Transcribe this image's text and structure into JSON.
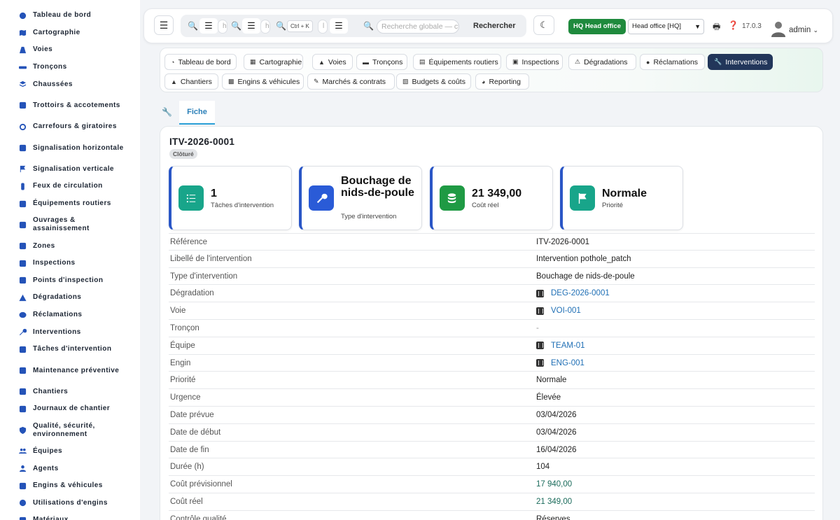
{
  "sidebar": {
    "items": [
      {
        "label": "Tableau de bord",
        "icon": "dashboard-icon"
      },
      {
        "label": "Cartographie",
        "icon": "map-icon"
      },
      {
        "label": "Voies",
        "icon": "road-icon"
      },
      {
        "label": "Tronçons",
        "icon": "segment-icon"
      },
      {
        "label": "Chaussées",
        "icon": "layers-icon"
      },
      {
        "label": "Trottoirs & accotements",
        "icon": "sidewalk-icon"
      },
      {
        "label": "Carrefours & giratoires",
        "icon": "roundabout-icon"
      },
      {
        "label": "Signalisation horizontale",
        "icon": "marking-icon"
      },
      {
        "label": "Signalisation verticale",
        "icon": "sign-icon"
      },
      {
        "label": "Feux de circulation",
        "icon": "traffic-light-icon"
      },
      {
        "label": "Équipements routiers",
        "icon": "equipment-icon"
      },
      {
        "label": "Ouvrages & assainissement",
        "icon": "water-icon"
      },
      {
        "label": "Zones",
        "icon": "zones-icon"
      },
      {
        "label": "Inspections",
        "icon": "clipboard-icon"
      },
      {
        "label": "Points d'inspection",
        "icon": "list-icon"
      },
      {
        "label": "Dégradations",
        "icon": "warning-icon"
      },
      {
        "label": "Réclamations",
        "icon": "comment-icon"
      },
      {
        "label": "Interventions",
        "icon": "wrench-icon"
      },
      {
        "label": "Tâches d'intervention",
        "icon": "tasks-icon"
      },
      {
        "label": "Maintenance préventive",
        "icon": "calendar-icon"
      },
      {
        "label": "Chantiers",
        "icon": "hardhat-icon"
      },
      {
        "label": "Journaux de chantier",
        "icon": "book-icon"
      },
      {
        "label": "Qualité, sécurité, environnement",
        "icon": "shield-icon"
      },
      {
        "label": "Équipes",
        "icon": "users-icon"
      },
      {
        "label": "Agents",
        "icon": "user-icon"
      },
      {
        "label": "Engins & véhicules",
        "icon": "truck-icon"
      },
      {
        "label": "Utilisations d'engins",
        "icon": "clock-icon"
      },
      {
        "label": "Matériaux",
        "icon": "box-icon"
      }
    ]
  },
  "topbar": {
    "search_fragments": [
      "he",
      "he",
      "l"
    ],
    "shortcut": "Ctrl + K",
    "global_placeholder": "Recherche globale — ctrl",
    "search_button": "Rechercher",
    "hq_badge": "HQ Head office",
    "hq_select": "Head office [HQ]",
    "version": "17.0.3",
    "user": "admin"
  },
  "module_tabs": [
    {
      "label": "Tableau de bord",
      "icon": "dashboard-icon"
    },
    {
      "label": "Cartographie",
      "icon": "map-icon"
    },
    {
      "label": "Voies",
      "icon": "road-icon"
    },
    {
      "label": "Tronçons",
      "icon": "segment-icon"
    },
    {
      "label": "Équipements routiers",
      "icon": "equipment-icon"
    },
    {
      "label": "Inspections",
      "icon": "clipboard-icon"
    },
    {
      "label": "Dégradations",
      "icon": "warning-icon"
    },
    {
      "label": "Réclamations",
      "icon": "comment-icon"
    },
    {
      "label": "Interventions",
      "icon": "wrench-icon",
      "active": true
    },
    {
      "label": "Chantiers",
      "icon": "hardhat-icon"
    },
    {
      "label": "Engins & véhicules",
      "icon": "truck-icon"
    },
    {
      "label": "Marchés & contrats",
      "icon": "contract-icon"
    },
    {
      "label": "Budgets & coûts",
      "icon": "coins-icon"
    },
    {
      "label": "Reporting",
      "icon": "chart-icon"
    }
  ],
  "subtab": {
    "label": "Fiche"
  },
  "record": {
    "title": "ITV-2026-0001",
    "status": "Clôturé",
    "stats": [
      {
        "value": "1",
        "label": "Tâches d'intervention",
        "color": "#18a58a"
      },
      {
        "value": "Bouchage de nids-de-poule",
        "label": "Type d'intervention",
        "color": "#2a5bd7"
      },
      {
        "value": "21 349,00",
        "label": "Coût réel",
        "color": "#1f9a44"
      },
      {
        "value": "Normale",
        "label": "Priorité",
        "color": "#18a58a"
      }
    ],
    "fields": [
      {
        "label": "Référence",
        "value": "ITV-2026-0001",
        "kind": "text"
      },
      {
        "label": "Libellé de l'intervention",
        "value": "Intervention pothole_patch",
        "kind": "text"
      },
      {
        "label": "Type d'intervention",
        "value": "Bouchage de nids-de-poule",
        "kind": "text"
      },
      {
        "label": "Dégradation",
        "value": "DEG-2026-0001",
        "kind": "link"
      },
      {
        "label": "Voie",
        "value": "VOI-001",
        "kind": "link"
      },
      {
        "label": "Tronçon",
        "value": "-",
        "kind": "dash"
      },
      {
        "label": "Équipe",
        "value": "TEAM-01",
        "kind": "link"
      },
      {
        "label": "Engin",
        "value": "ENG-001",
        "kind": "link"
      },
      {
        "label": "Priorité",
        "value": "Normale",
        "kind": "text"
      },
      {
        "label": "Urgence",
        "value": "Élevée",
        "kind": "text"
      },
      {
        "label": "Date prévue",
        "value": "03/04/2026",
        "kind": "text"
      },
      {
        "label": "Date de début",
        "value": "03/04/2026",
        "kind": "text"
      },
      {
        "label": "Date de fin",
        "value": "16/04/2026",
        "kind": "text"
      },
      {
        "label": "Durée (h)",
        "value": "104",
        "kind": "text"
      },
      {
        "label": "Coût prévisionnel",
        "value": "17 940,00",
        "kind": "money"
      },
      {
        "label": "Coût réel",
        "value": "21 349,00",
        "kind": "money"
      },
      {
        "label": "Contrôle qualité",
        "value": "Réserves",
        "kind": "text"
      }
    ]
  }
}
